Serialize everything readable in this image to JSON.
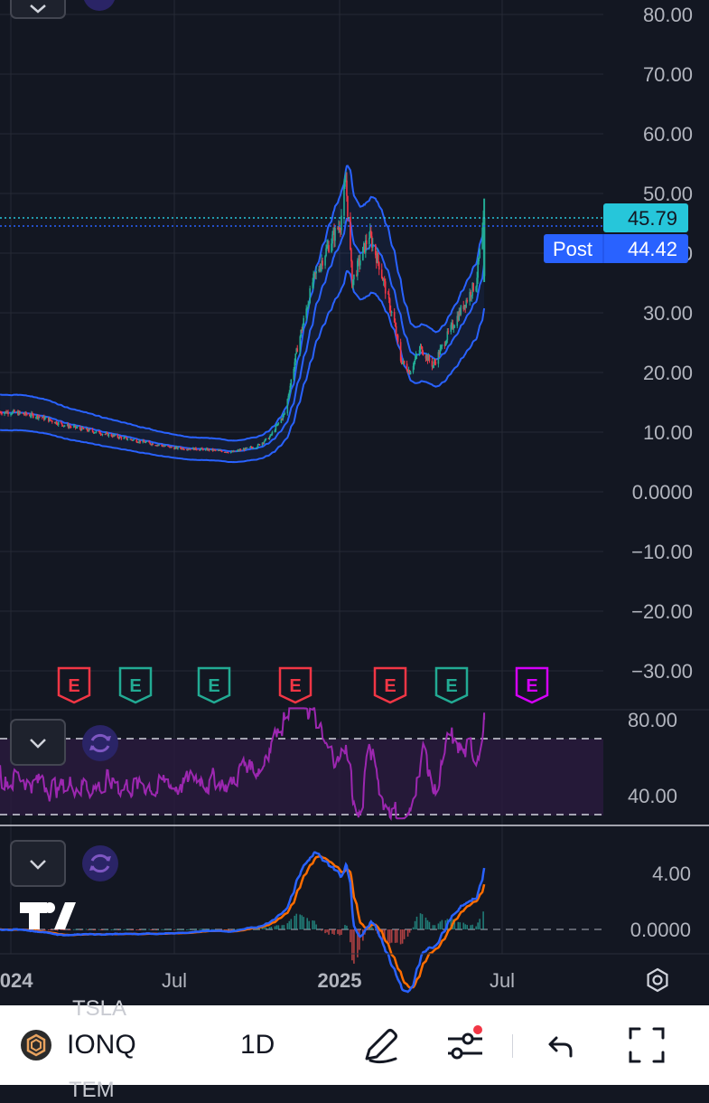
{
  "price_axis": [
    "80.00",
    "70.00",
    "60.00",
    "50.00",
    "40.00",
    "30.00",
    "20.00",
    "10.00",
    "0.0000",
    "−10.00",
    "−20.00",
    "−30.00"
  ],
  "price_tags": [
    {
      "label": "",
      "value": "45.79",
      "color": "#26c6da",
      "text_color": "#131722"
    },
    {
      "label": "Post",
      "value": "44.42",
      "color": "#2962ff",
      "text_color": "#ffffff"
    }
  ],
  "earnings_markers": [
    {
      "label": "E",
      "color": "#f23645",
      "date": "2024-02-28"
    },
    {
      "label": "E",
      "color": "#22ab94",
      "date": "2024-05-08"
    },
    {
      "label": "E",
      "color": "#22ab94",
      "date": "2024-08-07"
    },
    {
      "label": "E",
      "color": "#f23645",
      "date": "2024-11-06"
    },
    {
      "label": "E",
      "color": "#f23645",
      "date": "2025-02-26"
    },
    {
      "label": "E",
      "color": "#22ab94",
      "date": "2025-05-07"
    },
    {
      "label": "E",
      "color": "#d500f9",
      "date": "2025-08-06"
    }
  ],
  "rsi_axis": [
    "80.00",
    "40.00"
  ],
  "macd_axis": [
    "4.00",
    "0.0000"
  ],
  "time_axis": [
    {
      "label": "2024",
      "bold": true,
      "date": "2024-01-01"
    },
    {
      "label": "Jul",
      "bold": false,
      "date": "2024-07-01"
    },
    {
      "label": "2025",
      "bold": true,
      "date": "2025-01-01"
    },
    {
      "label": "Jul",
      "bold": false,
      "date": "2025-07-01"
    }
  ],
  "bottom_bar": {
    "symbol": "IONQ",
    "interval": "1D",
    "ghost_top": "TSLA",
    "ghost_bottom": "TEM"
  },
  "colors": {
    "up": "#22ab94",
    "down": "#f23645",
    "band": "#2962ff",
    "rsi": "#9c27b0",
    "macd": "#2962ff",
    "signal": "#ff6d00"
  },
  "chart_data": {
    "type": "line",
    "title": "",
    "symbol": "IONQ",
    "interval": "1D",
    "ylim": [
      -33,
      85
    ],
    "grid": true,
    "series": [
      {
        "name": "",
        "x": [
          "2024-01-02",
          "2024-02-01",
          "2024-03-01",
          "2024-04-01",
          "2024-05-01",
          "2024-06-03",
          "2024-07-01",
          "2024-08-01",
          "2024-09-03",
          "2024-10-01",
          "2024-10-15",
          "2024-11-01",
          "2024-11-15",
          "2024-12-02",
          "2024-12-16",
          "2025-01-02",
          "2025-01-08",
          "2025-01-15",
          "2025-02-03",
          "2025-02-14",
          "2025-03-03",
          "2025-03-10",
          "2025-03-20",
          "2025-04-01",
          "2025-04-15",
          "2025-05-01",
          "2025-05-15",
          "2025-06-02",
          "2025-06-11"
        ],
        "values": [
          13.2,
          12.5,
          11.0,
          10.0,
          9.0,
          8.0,
          7.2,
          7.0,
          6.5,
          7.5,
          9.0,
          13.0,
          24.0,
          35.0,
          40.0,
          45.0,
          52.0,
          35.0,
          43.0,
          38.0,
          28.0,
          22.0,
          20.0,
          24.0,
          21.0,
          26.0,
          30.0,
          35.0,
          45.79
        ]
      }
    ],
    "last_price": 45.79,
    "post_market_price": 44.42
  }
}
